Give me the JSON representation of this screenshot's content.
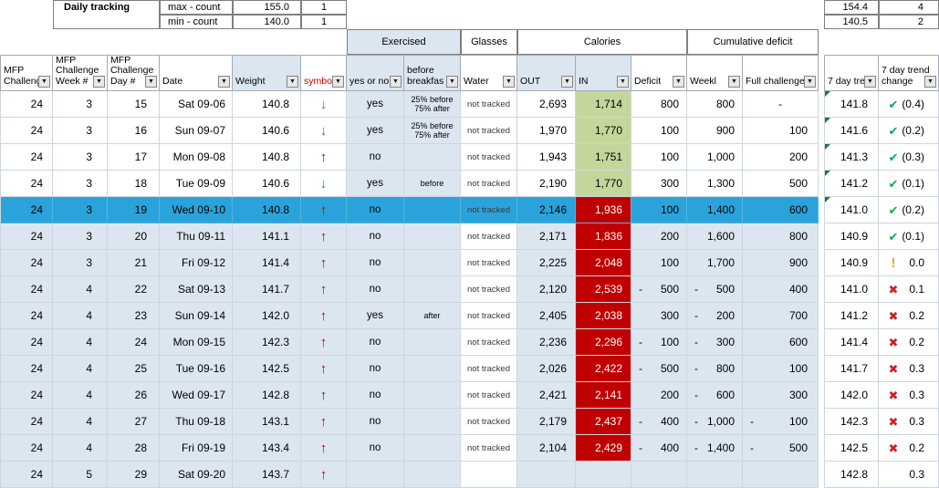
{
  "title": "Daily tracking",
  "stats": {
    "max_label": "max - count",
    "max_value": "155.0",
    "max_count": "1",
    "min_label": "min - count",
    "min_value": "140.0",
    "min_count": "1",
    "trend_max_value": "154.4",
    "trend_max_count": "4",
    "trend_min_value": "140.5",
    "trend_min_count": "2"
  },
  "group_headers": {
    "exercised": "Exercised",
    "glasses": "Glasses",
    "calories": "Calories",
    "cumulative_deficit": "Cumulative deficit"
  },
  "column_headers": [
    "MFP Challeng",
    "MFP Challenge Week #",
    "MFP Challenge Day #",
    "Date",
    "Weight",
    "symbo",
    "yes or no",
    "before breakfas",
    "Water",
    "OUT",
    "IN",
    "Deficit",
    "Weekl",
    "Full challenge",
    "7 day tre",
    "7 day trend change"
  ],
  "colors": {
    "selected_row": "#2AA3DA",
    "row_band": "#DCE6F1",
    "calories_in_good": "#C4D79B",
    "calories_in_bad": "#C00000",
    "up_arrow": "#C00000",
    "down_arrow": "#00A550",
    "check_icon": "#00B050",
    "x_icon": "#CC2222",
    "warning_icon": "#EDA63A",
    "symbol_header_text": "#C00000"
  },
  "rows": [
    {
      "mfp": "24",
      "week": "3",
      "day": "15",
      "date": "Sat 09-06",
      "weight": "140.8",
      "symbol": "down",
      "exercised": "yes",
      "before": "25% before\n75% after",
      "water": "not tracked",
      "out": "2,693",
      "in": "1,714",
      "in_state": "good",
      "deficit": "800",
      "weekly": "800",
      "full": "-",
      "trend": "141.8",
      "status": "check",
      "change": "(0.4)",
      "selected": false,
      "band": false,
      "flag": true
    },
    {
      "mfp": "24",
      "week": "3",
      "day": "16",
      "date": "Sun 09-07",
      "weight": "140.6",
      "symbol": "down",
      "exercised": "yes",
      "before": "25% before\n75% after",
      "water": "not tracked",
      "out": "1,970",
      "in": "1,770",
      "in_state": "good",
      "deficit": "100",
      "weekly": "900",
      "full": "100",
      "trend": "141.6",
      "status": "check",
      "change": "(0.2)",
      "selected": false,
      "band": false,
      "flag": true
    },
    {
      "mfp": "24",
      "week": "3",
      "day": "17",
      "date": "Mon 09-08",
      "weight": "140.8",
      "symbol": "up",
      "exercised": "no",
      "before": "",
      "water": "not tracked",
      "out": "1,943",
      "in": "1,751",
      "in_state": "good",
      "deficit": "100",
      "weekly": "1,000",
      "full": "200",
      "trend": "141.3",
      "status": "check",
      "change": "(0.3)",
      "selected": false,
      "band": false,
      "flag": true
    },
    {
      "mfp": "24",
      "week": "3",
      "day": "18",
      "date": "Tue 09-09",
      "weight": "140.6",
      "symbol": "down",
      "exercised": "yes",
      "before": "before",
      "water": "not tracked",
      "out": "2,190",
      "in": "1,770",
      "in_state": "good",
      "deficit": "300",
      "weekly": "1,300",
      "full": "500",
      "trend": "141.2",
      "status": "check",
      "change": "(0.1)",
      "selected": false,
      "band": false,
      "flag": true
    },
    {
      "mfp": "24",
      "week": "3",
      "day": "19",
      "date": "Wed 09-10",
      "weight": "140.8",
      "symbol": "up",
      "exercised": "no",
      "before": "",
      "water": "not tracked",
      "out": "2,146",
      "in": "1,936",
      "in_state": "bad",
      "deficit": "100",
      "weekly": "1,400",
      "full": "600",
      "trend": "141.0",
      "status": "check",
      "change": "(0.2)",
      "selected": true,
      "band": false,
      "flag": true
    },
    {
      "mfp": "24",
      "week": "3",
      "day": "20",
      "date": "Thu 09-11",
      "weight": "141.1",
      "symbol": "up",
      "exercised": "no",
      "before": "",
      "water": "not tracked",
      "out": "2,171",
      "in": "1,836",
      "in_state": "bad",
      "deficit": "200",
      "weekly": "1,600",
      "full": "800",
      "trend": "140.9",
      "status": "check",
      "change": "(0.1)",
      "selected": false,
      "band": true,
      "flag": false
    },
    {
      "mfp": "24",
      "week": "3",
      "day": "21",
      "date": "Fri 09-12",
      "weight": "141.4",
      "symbol": "up",
      "exercised": "no",
      "before": "",
      "water": "not tracked",
      "out": "2,225",
      "in": "2,048",
      "in_state": "bad",
      "deficit": "100",
      "weekly": "1,700",
      "full": "900",
      "trend": "140.9",
      "status": "warn",
      "change": "0.0",
      "selected": false,
      "band": true,
      "flag": false
    },
    {
      "mfp": "24",
      "week": "4",
      "day": "22",
      "date": "Sat 09-13",
      "weight": "141.7",
      "symbol": "up",
      "exercised": "no",
      "before": "",
      "water": "not tracked",
      "out": "2,120",
      "in": "2,539",
      "in_state": "bad",
      "deficit": "- 500",
      "weekly": "- 500",
      "full": "400",
      "trend": "141.0",
      "status": "x",
      "change": "0.1",
      "selected": false,
      "band": true,
      "flag": false
    },
    {
      "mfp": "24",
      "week": "4",
      "day": "23",
      "date": "Sun 09-14",
      "weight": "142.0",
      "symbol": "up",
      "exercised": "yes",
      "before": "after",
      "water": "not tracked",
      "out": "2,405",
      "in": "2,038",
      "in_state": "bad",
      "deficit": "300",
      "weekly": "- 200",
      "full": "700",
      "trend": "141.2",
      "status": "x",
      "change": "0.2",
      "selected": false,
      "band": true,
      "flag": false
    },
    {
      "mfp": "24",
      "week": "4",
      "day": "24",
      "date": "Mon 09-15",
      "weight": "142.3",
      "symbol": "up",
      "exercised": "no",
      "before": "",
      "water": "not tracked",
      "out": "2,236",
      "in": "2,296",
      "in_state": "bad",
      "deficit": "- 100",
      "weekly": "- 300",
      "full": "600",
      "trend": "141.4",
      "status": "x",
      "change": "0.2",
      "selected": false,
      "band": true,
      "flag": false
    },
    {
      "mfp": "24",
      "week": "4",
      "day": "25",
      "date": "Tue 09-16",
      "weight": "142.5",
      "symbol": "up",
      "exercised": "no",
      "before": "",
      "water": "not tracked",
      "out": "2,026",
      "in": "2,422",
      "in_state": "bad",
      "deficit": "- 500",
      "weekly": "- 800",
      "full": "100",
      "trend": "141.7",
      "status": "x",
      "change": "0.3",
      "selected": false,
      "band": true,
      "flag": false
    },
    {
      "mfp": "24",
      "week": "4",
      "day": "26",
      "date": "Wed 09-17",
      "weight": "142.8",
      "symbol": "up",
      "exercised": "no",
      "before": "",
      "water": "not tracked",
      "out": "2,421",
      "in": "2,141",
      "in_state": "bad",
      "deficit": "200",
      "weekly": "- 600",
      "full": "300",
      "trend": "142.0",
      "status": "x",
      "change": "0.3",
      "selected": false,
      "band": true,
      "flag": false
    },
    {
      "mfp": "24",
      "week": "4",
      "day": "27",
      "date": "Thu 09-18",
      "weight": "143.1",
      "symbol": "up",
      "exercised": "no",
      "before": "",
      "water": "not tracked",
      "out": "2,179",
      "in": "2,437",
      "in_state": "bad",
      "deficit": "- 400",
      "weekly": "- 1,000",
      "full": "- 100",
      "trend": "142.3",
      "status": "x",
      "change": "0.3",
      "selected": false,
      "band": true,
      "flag": false
    },
    {
      "mfp": "24",
      "week": "4",
      "day": "28",
      "date": "Fri 09-19",
      "weight": "143.4",
      "symbol": "up",
      "exercised": "no",
      "before": "",
      "water": "not tracked",
      "out": "2,104",
      "in": "2,429",
      "in_state": "bad",
      "deficit": "- 400",
      "weekly": "- 1,400",
      "full": "- 500",
      "trend": "142.5",
      "status": "x",
      "change": "0.2",
      "selected": false,
      "band": true,
      "flag": false
    },
    {
      "mfp": "24",
      "week": "5",
      "day": "29",
      "date": "Sat 09-20",
      "weight": "143.7",
      "symbol": "up",
      "exercised": "",
      "before": "",
      "water": "",
      "out": "",
      "in": "",
      "in_state": "",
      "deficit": "",
      "weekly": "",
      "full": "",
      "trend": "142.8",
      "status": "",
      "change": "0.3",
      "selected": false,
      "band": true,
      "flag": false
    }
  ]
}
